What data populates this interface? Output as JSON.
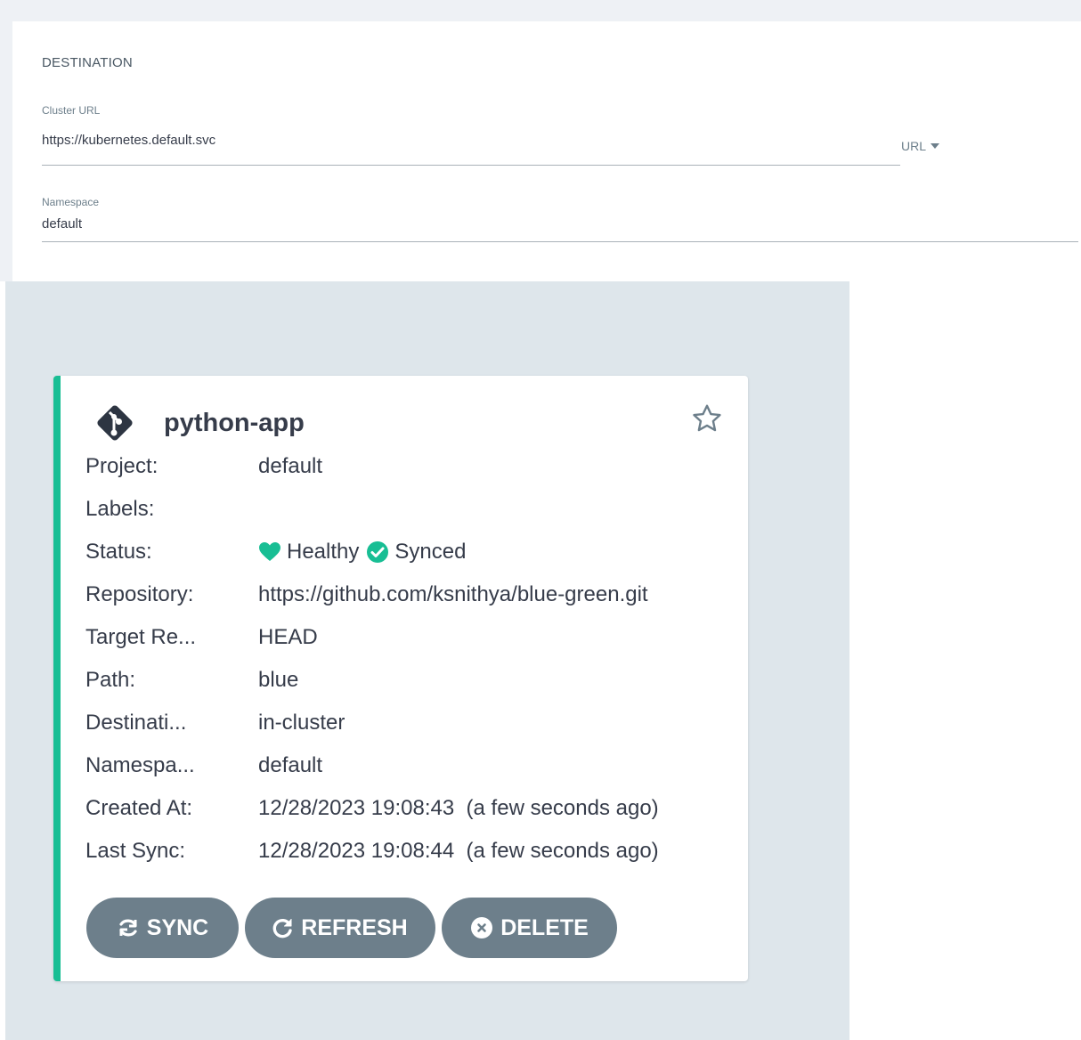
{
  "destination": {
    "title": "DESTINATION",
    "cluster_url": {
      "label": "Cluster URL",
      "value": "https://kubernetes.default.svc",
      "type_selector": "URL"
    },
    "namespace": {
      "label": "Namespace",
      "value": "default"
    }
  },
  "app_card": {
    "name": "python-app",
    "icon": "git-diamond-icon",
    "favorite_icon": "star-outline-icon",
    "accent_color": "#18be94",
    "rows": {
      "project": {
        "key": "Project:",
        "value": "default"
      },
      "labels": {
        "key": "Labels:",
        "value": ""
      },
      "status": {
        "key": "Status:",
        "health": "Healthy",
        "sync": "Synced",
        "health_color": "#18be94",
        "sync_color": "#18be94"
      },
      "repository": {
        "key": "Repository:",
        "value": "https://github.com/ksnithya/blue-green.git"
      },
      "target_revision": {
        "key": "Target Re...",
        "value": "HEAD"
      },
      "path": {
        "key": "Path:",
        "value": "blue"
      },
      "destination": {
        "key": "Destinati...",
        "value": "in-cluster"
      },
      "namespace": {
        "key": "Namespa...",
        "value": "default"
      },
      "created_at": {
        "key": "Created At:",
        "value": "12/28/2023 19:08:43  (a few seconds ago)"
      },
      "last_sync": {
        "key": "Last Sync:",
        "value": "12/28/2023 19:08:44  (a few seconds ago)"
      }
    },
    "buttons": {
      "sync": {
        "label": "SYNC",
        "icon": "sync-icon"
      },
      "refresh": {
        "label": "REFRESH",
        "icon": "redo-icon"
      },
      "delete": {
        "label": "DELETE",
        "icon": "close-circle-icon"
      }
    }
  }
}
